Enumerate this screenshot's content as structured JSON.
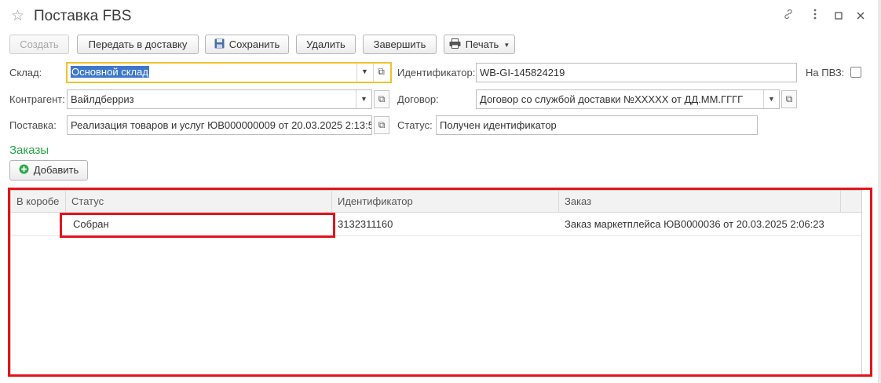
{
  "window": {
    "title": "Поставка FBS",
    "icons": [
      "star-icon",
      "link-icon",
      "more-icon",
      "minimize-icon",
      "close-icon"
    ]
  },
  "toolbar": {
    "create_label": "Создать",
    "transfer_label": "Передать в доставку",
    "save_label": "Сохранить",
    "delete_label": "Удалить",
    "finish_label": "Завершить",
    "print_label": "Печать"
  },
  "form": {
    "warehouse_label": "Склад:",
    "warehouse_value": "Основной склад",
    "counterparty_label": "Контрагент:",
    "counterparty_value": "Вайлдберриз",
    "supply_label": "Поставка:",
    "supply_value": "Реализация товаров и услуг ЮВ000000009 от 20.03.2025 2:13:5",
    "identifier_label": "Идентификатор:",
    "identifier_value": "WB-GI-145824219",
    "contract_label": "Договор:",
    "contract_value": "Договор со службой доставки №XXXXX от ДД.ММ.ГГГГ",
    "status_label": "Статус:",
    "status_value": "Получен идентификатор",
    "pvz_label": "На ПВЗ:",
    "pvz_checked": false
  },
  "orders": {
    "section_title": "Заказы",
    "add_label": "Добавить",
    "columns": [
      "В коробе",
      "Статус",
      "Идентификатор",
      "Заказ"
    ],
    "rows": [
      {
        "in_box": "",
        "status": "Собран",
        "identifier": "3132311160",
        "order": "Заказ маркетплейса ЮВ0000036 от 20.03.2025 2:06:23"
      }
    ]
  },
  "colors": {
    "highlight": "#e2141b",
    "section_title": "#27a445",
    "focus_border": "#f1c22b",
    "selection": "#3e77c9"
  }
}
